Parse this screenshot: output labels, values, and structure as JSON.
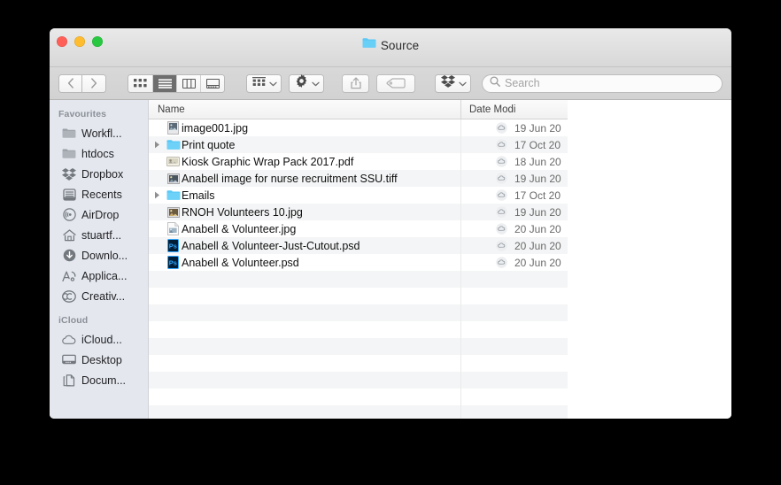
{
  "window": {
    "title": "Source",
    "title_icon": "folder-icon",
    "traffic_lights": [
      "close",
      "minimize",
      "maximize"
    ]
  },
  "toolbar": {
    "back_label": "Back",
    "forward_label": "Forward",
    "view_modes": [
      {
        "name": "icon-view",
        "selected": false
      },
      {
        "name": "list-view",
        "selected": true
      },
      {
        "name": "column-view",
        "selected": false
      },
      {
        "name": "gallery-view",
        "selected": false
      }
    ],
    "group_by_label": "Group items",
    "action_label": "Action",
    "share_label": "Share",
    "tag_label": "Tags",
    "dropbox_label": "Dropbox"
  },
  "search": {
    "placeholder": "Search",
    "value": ""
  },
  "sidebar": {
    "sections": [
      {
        "header": "Favourites",
        "items": [
          {
            "label": "Workfl...",
            "icon": "folder-icon"
          },
          {
            "label": "htdocs",
            "icon": "folder-icon"
          },
          {
            "label": "Dropbox",
            "icon": "dropbox-icon"
          },
          {
            "label": "Recents",
            "icon": "recents-icon"
          },
          {
            "label": "AirDrop",
            "icon": "airdrop-icon"
          },
          {
            "label": "stuartf...",
            "icon": "home-icon"
          },
          {
            "label": "Downlo...",
            "icon": "downloads-icon"
          },
          {
            "label": "Applica...",
            "icon": "applications-icon"
          },
          {
            "label": "Creativ...",
            "icon": "creative-cloud-icon"
          }
        ]
      },
      {
        "header": "iCloud",
        "items": [
          {
            "label": "iCloud...",
            "icon": "cloud-icon"
          },
          {
            "label": "Desktop",
            "icon": "desktop-icon"
          },
          {
            "label": "Docum...",
            "icon": "documents-icon"
          }
        ]
      }
    ]
  },
  "file_list": {
    "columns": [
      "Name",
      "Date Modi"
    ],
    "rows": [
      {
        "name": "image001.jpg",
        "date": "19 Jun 20",
        "icon": "image-file-icon",
        "expandable": false,
        "sync": "dropbox-sync-icon"
      },
      {
        "name": "Print quote",
        "date": "17 Oct 20",
        "icon": "folder-icon",
        "expandable": true,
        "sync": "dropbox-sync-icon"
      },
      {
        "name": "Kiosk Graphic Wrap Pack 2017.pdf",
        "date": "18 Jun 20",
        "icon": "pdf-file-icon",
        "expandable": false,
        "sync": "dropbox-sync-icon"
      },
      {
        "name": "Anabell image for nurse recruitment SSU.tiff",
        "date": "19 Jun 20",
        "icon": "tiff-file-icon",
        "expandable": false,
        "sync": "dropbox-sync-icon"
      },
      {
        "name": "Emails",
        "date": "17 Oct 20",
        "icon": "folder-icon",
        "expandable": true,
        "sync": "dropbox-sync-icon"
      },
      {
        "name": "RNOH Volunteers 10.jpg",
        "date": "19 Jun 20",
        "icon": "image-file-icon",
        "expandable": false,
        "sync": "dropbox-sync-icon"
      },
      {
        "name": "Anabell & Volunteer.jpg",
        "date": "20 Jun 20",
        "icon": "jpg-file-icon",
        "expandable": false,
        "sync": "dropbox-sync-icon"
      },
      {
        "name": "Anabell & Volunteer-Just-Cutout.psd",
        "date": "20 Jun 20",
        "icon": "psd-file-icon",
        "expandable": false,
        "sync": "dropbox-sync-icon"
      },
      {
        "name": "Anabell & Volunteer.psd",
        "date": "20 Jun 20",
        "icon": "psd-file-icon",
        "expandable": false,
        "sync": "dropbox-sync-icon"
      }
    ],
    "empty_row_count": 10
  },
  "colors": {
    "folder_blue": "#5ac8f5",
    "sidebar_bg": "#e4e7ee",
    "row_stripe": "#f4f5f6",
    "selected_segment": "#6e6e6e",
    "psd_blue": "#001e36",
    "psd_accent": "#31a8ff"
  }
}
